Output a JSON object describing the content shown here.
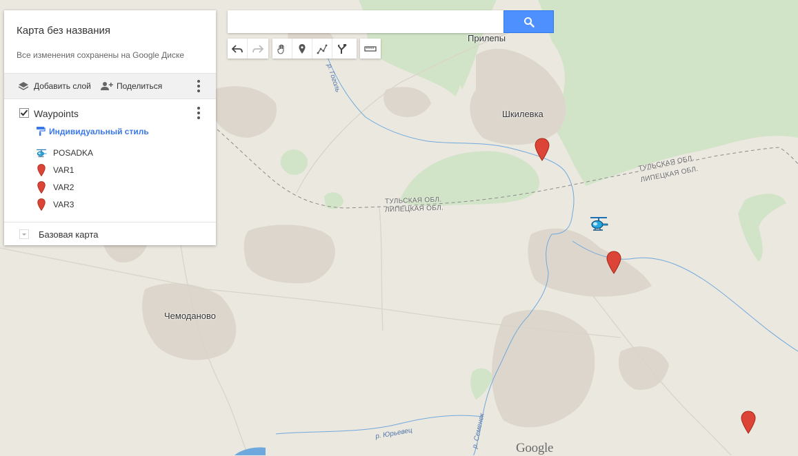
{
  "panel": {
    "title": "Карта без названия",
    "subtitle": "Все изменения сохранены на Google Диске",
    "add_layer_label": "Добавить слой",
    "share_label": "Поделиться",
    "layer": {
      "title": "Waypoints",
      "checked": true,
      "style_label": "Индивидуальный стиль",
      "items": [
        {
          "label": "POSADKA",
          "icon": "helicopter-icon"
        },
        {
          "label": "VAR1",
          "icon": "red-pin-icon"
        },
        {
          "label": "VAR2",
          "icon": "red-pin-icon"
        },
        {
          "label": "VAR3",
          "icon": "red-pin-icon"
        }
      ]
    },
    "basemap_label": "Базовая карта"
  },
  "search": {
    "value": "",
    "placeholder": ""
  },
  "toolbar": {
    "tools": [
      "undo-icon",
      "redo-icon",
      "hand-icon",
      "add-marker-icon",
      "draw-line-icon",
      "directions-icon",
      "ruler-icon"
    ]
  },
  "map": {
    "places": {
      "prilepy": "Прилепы",
      "shkilevka": "Шкилевка",
      "chemodanovo": "Чемоданово"
    },
    "borders": {
      "tula_1": "ТУЛЬСКАЯ ОБЛ.",
      "lipetsk_1": "ЛИПЕЦКАЯ ОБЛ.",
      "tula_2": "ТУЛЬСКАЯ ОБЛ.",
      "lipetsk_2": "ЛИПЕЦКАЯ ОБЛ."
    },
    "rivers": {
      "gogol": "р. Гоголь",
      "yurevets": "р. Юрьевец",
      "semenek": "р. Семенек"
    },
    "logo": "Google",
    "colors": {
      "land": "#ebe8e0",
      "forest": "#d2e4c8",
      "settlement": "#ddd6cc",
      "water": "#6fa8dc",
      "pin": "#db4437",
      "search_button": "#4d90fe",
      "link": "#3b78e7"
    }
  }
}
